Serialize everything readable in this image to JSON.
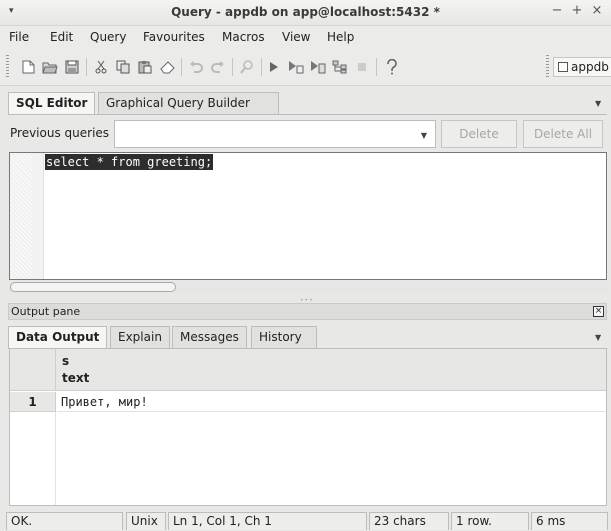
{
  "window": {
    "title": "Query - appdb on app@localhost:5432 *",
    "minimize_glyph": "−",
    "maximize_glyph": "+",
    "close_glyph": "×",
    "menu_glyph": "▾"
  },
  "menubar": {
    "items": [
      "File",
      "Edit",
      "Query",
      "Favourites",
      "Macros",
      "View",
      "Help"
    ]
  },
  "toolbar": {
    "checkbox_label": "appdb",
    "icons": [
      "new-document-icon",
      "open-folder-icon",
      "save-icon",
      "cut-icon",
      "copy-icon",
      "paste-icon",
      "clear-icon",
      "undo-icon",
      "redo-icon",
      "find-icon",
      "execute-icon",
      "execute-pgscript-icon",
      "execute-to-file-icon",
      "explain-icon",
      "cancel-icon",
      "help-icon"
    ]
  },
  "editor_tabs": {
    "items": [
      "SQL Editor",
      "Graphical Query Builder"
    ],
    "active": "SQL Editor"
  },
  "previous_queries": {
    "label": "Previous queries",
    "value": "",
    "delete_label": "Delete",
    "delete_all_label": "Delete All"
  },
  "editor": {
    "text": "select * from greeting;"
  },
  "output_pane": {
    "label": "Output pane",
    "tabs": [
      "Data Output",
      "Explain",
      "Messages",
      "History"
    ],
    "active": "Data Output"
  },
  "result_grid": {
    "columns": [
      {
        "name": "s",
        "type": "text"
      }
    ],
    "rows": [
      {
        "num": "1",
        "values": [
          "Привет, мир!"
        ]
      }
    ]
  },
  "statusbar": {
    "status": "OK.",
    "line_ending": "Unix",
    "position": "Ln 1, Col 1, Ch 1",
    "chars": "23 chars",
    "rows": "1 row.",
    "time": "6 ms"
  },
  "colors": {
    "selection_bg": "#2d2d2d",
    "window_bg": "#e8e8e7"
  }
}
